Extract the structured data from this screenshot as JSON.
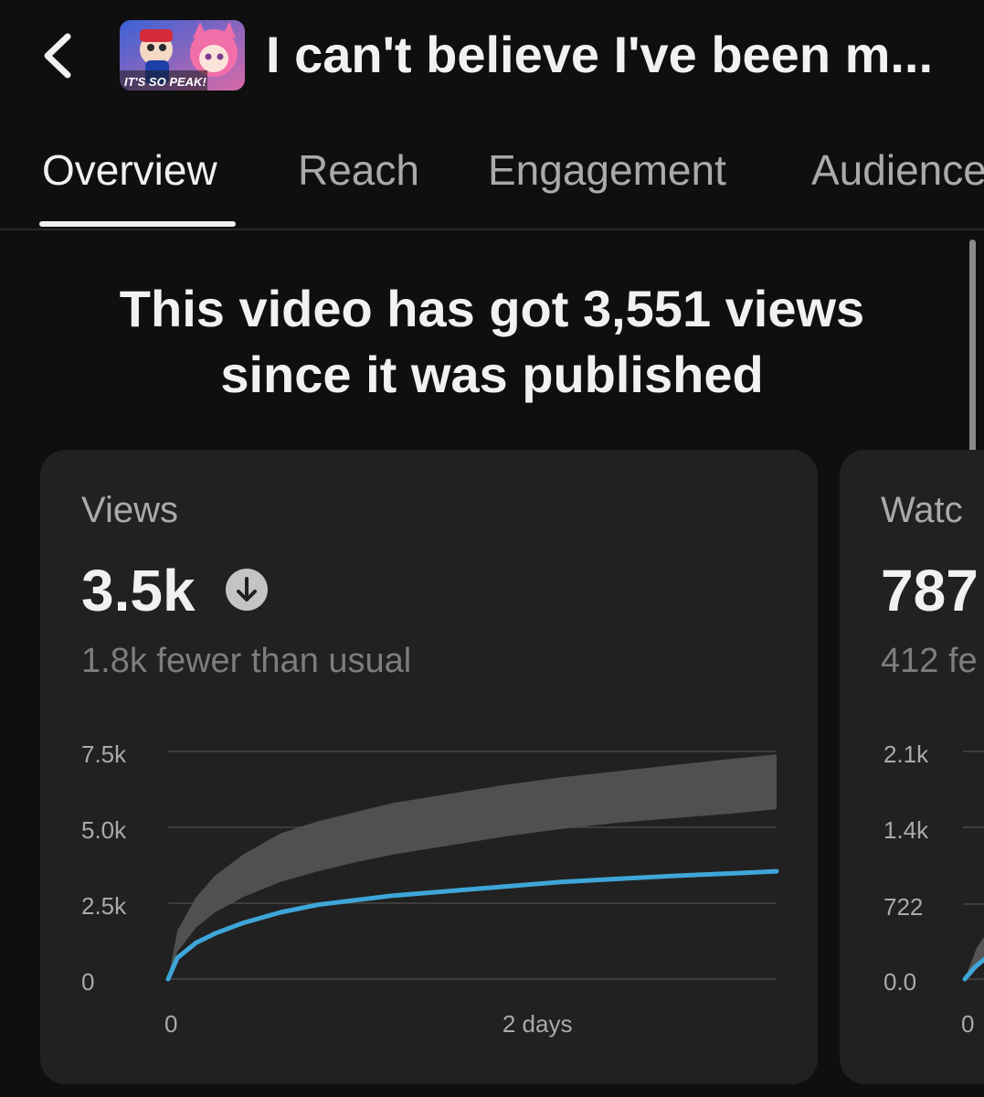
{
  "header": {
    "back_icon": "chevron-left-icon",
    "thumbnail_caption": "IT'S SO PEAK!",
    "title": "I can't believe I've been m..."
  },
  "tabs": [
    {
      "label": "Overview",
      "active": true
    },
    {
      "label": "Reach",
      "active": false
    },
    {
      "label": "Engagement",
      "active": false
    },
    {
      "label": "Audience",
      "active": false
    }
  ],
  "headline": {
    "line1": "This video has got 3,551 views",
    "line2": "since it was published"
  },
  "cards": {
    "views": {
      "label": "Views",
      "value": "3.5k",
      "trend_icon": "arrow-down-icon",
      "subtitle": "1.8k fewer than usual"
    },
    "watch_time": {
      "label": "Watc",
      "value": "787",
      "subtitle": "412 fe",
      "ticks": [
        "2.1k",
        "1.4k",
        "722",
        "0.0"
      ],
      "x_tick": "0"
    }
  },
  "colors": {
    "background": "#0f0f0f",
    "card": "#212121",
    "line": "#3ea6d8",
    "band": "#555555"
  },
  "chart_data": {
    "type": "line",
    "title": "",
    "xlabel": "",
    "ylabel": "",
    "x_tick_labels": [
      "0",
      "2 days"
    ],
    "y_tick_labels": [
      "0",
      "2.5k",
      "5.0k",
      "7.5k"
    ],
    "ylim": [
      0,
      7500
    ],
    "xlim": [
      0,
      3.25
    ],
    "grid": true,
    "legend": "none",
    "series": [
      {
        "kind": "line",
        "x": [
          0,
          0.05,
          0.15,
          0.25,
          0.4,
          0.6,
          0.8,
          1.0,
          1.2,
          1.5,
          1.8,
          2.1,
          2.4,
          2.7,
          3.0,
          3.25
        ],
        "values": [
          0,
          700,
          1200,
          1500,
          1850,
          2200,
          2450,
          2600,
          2750,
          2900,
          3050,
          3200,
          3300,
          3400,
          3480,
          3551
        ]
      },
      {
        "kind": "band",
        "x": [
          0,
          0.05,
          0.15,
          0.25,
          0.4,
          0.6,
          0.8,
          1.0,
          1.2,
          1.5,
          1.8,
          2.1,
          2.4,
          2.7,
          3.0,
          3.25
        ],
        "upper": [
          0,
          1600,
          2700,
          3400,
          4100,
          4800,
          5200,
          5500,
          5800,
          6100,
          6400,
          6650,
          6850,
          7050,
          7250,
          7400
        ],
        "lower": [
          0,
          900,
          1700,
          2200,
          2700,
          3200,
          3550,
          3850,
          4100,
          4400,
          4700,
          4950,
          5150,
          5300,
          5450,
          5600
        ]
      }
    ]
  }
}
